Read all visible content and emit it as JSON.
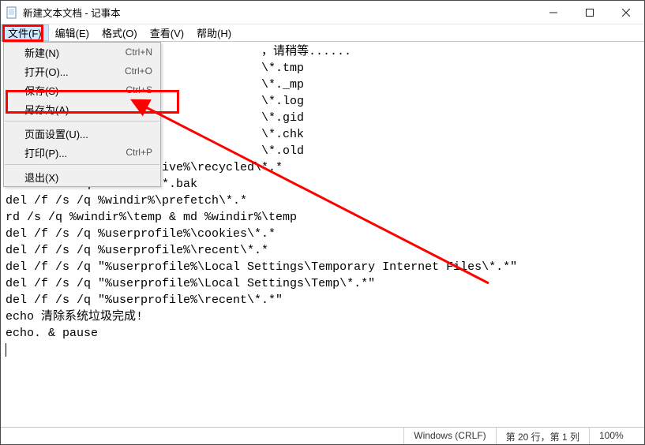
{
  "title": "新建文本文档 - 记事本",
  "menubar": {
    "file": "文件(F)",
    "edit": "编辑(E)",
    "format": "格式(O)",
    "view": "查看(V)",
    "help": "帮助(H)"
  },
  "fileMenu": {
    "new_label": "新建(N)",
    "new_sc": "Ctrl+N",
    "open_label": "打开(O)...",
    "open_sc": "Ctrl+O",
    "save_label": "保存(S)",
    "save_sc": "Ctrl+S",
    "saveas_label": "另存为(A)...",
    "pagesetup_label": "页面设置(U)...",
    "print_label": "打印(P)...",
    "print_sc": "Ctrl+P",
    "exit_label": "退出(X)"
  },
  "editor_text": "                                    ，请稍等......\n                                    \\*.tmp\n                                    \\*._mp\n                                    \\*.log\n                                    \\*.gid\n                                    \\*.chk\n                                    \\*.old\ndel /f /s /q %systemdrive%\\recycled\\*.*\ndel /f /s /q %windir%\\*.bak\ndel /f /s /q %windir%\\prefetch\\*.*\nrd /s /q %windir%\\temp & md %windir%\\temp\ndel /f /s /q %userprofile%\\cookies\\*.*\ndel /f /s /q %userprofile%\\recent\\*.*\ndel /f /s /q \"%userprofile%\\Local Settings\\Temporary Internet Files\\*.*\"\ndel /f /s /q \"%userprofile%\\Local Settings\\Temp\\*.*\"\ndel /f /s /q \"%userprofile%\\recent\\*.*\"\necho 清除系统垃圾完成!\necho. & pause",
  "statusbar": {
    "encoding": "Windows (CRLF)",
    "position": "第 20 行，第 1 列",
    "zoom": "100%"
  }
}
